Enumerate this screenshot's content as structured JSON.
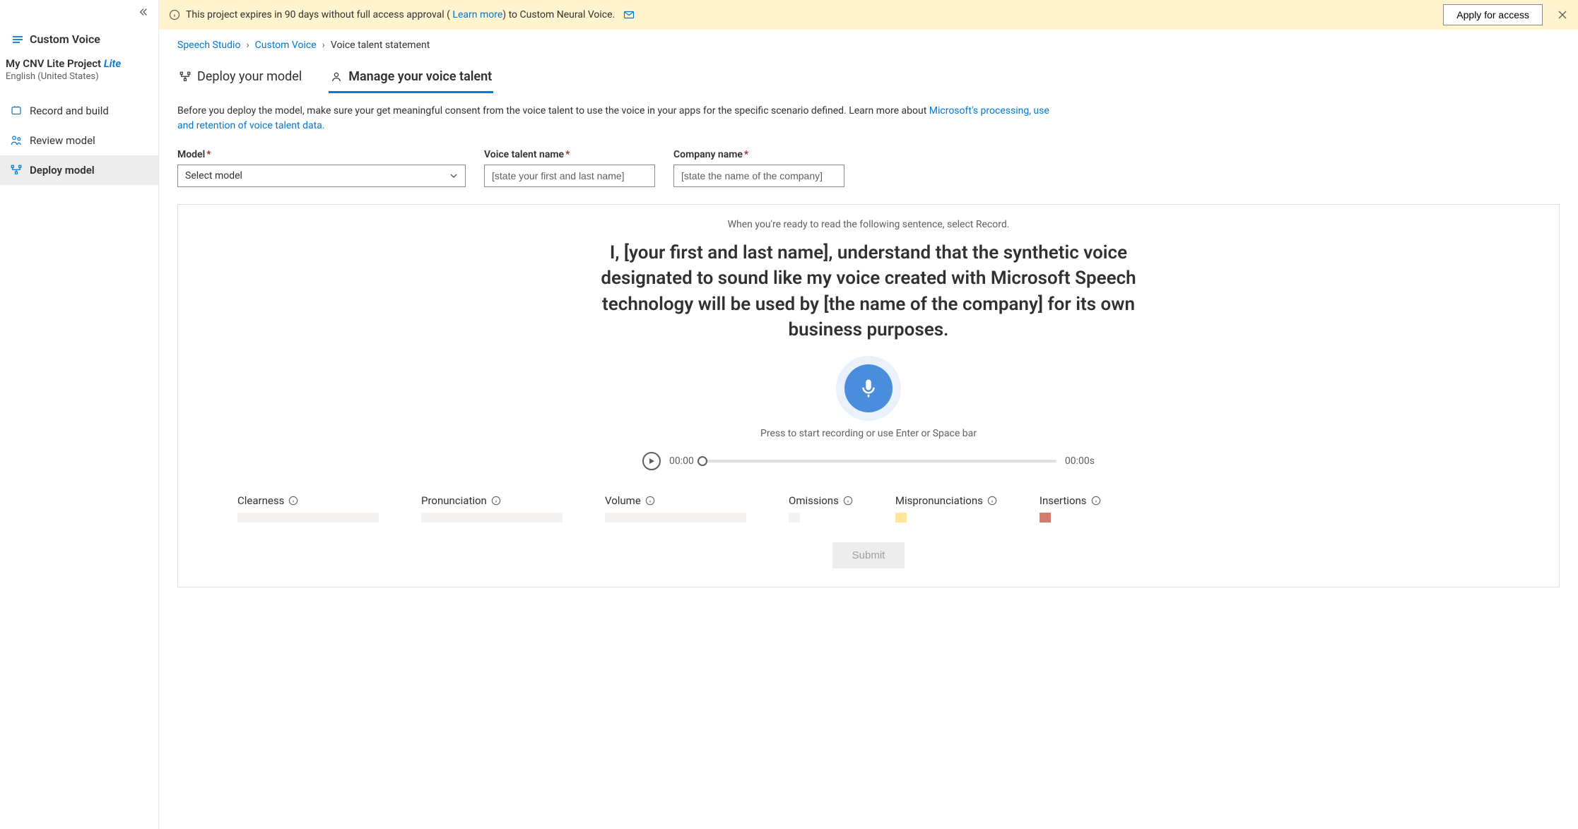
{
  "sidebar": {
    "app_name": "Custom Voice",
    "project_name": "My CNV Lite Project",
    "project_badge": "Lite",
    "project_lang": "English (United States)",
    "items": [
      {
        "label": "Record and build"
      },
      {
        "label": "Review model"
      },
      {
        "label": "Deploy model"
      }
    ]
  },
  "banner": {
    "text_pre": "This project expires in 90 days without full access approval ( ",
    "learn_more": "Learn more",
    "text_post": ") to Custom Neural Voice.",
    "apply_btn": "Apply for access"
  },
  "breadcrumb": {
    "a": "Speech Studio",
    "b": "Custom Voice",
    "c": "Voice talent statement"
  },
  "tabs": {
    "deploy": "Deploy your model",
    "manage": "Manage your voice talent"
  },
  "desc": {
    "text": "Before you deploy the model, make sure your get meaningful consent from the voice talent to use the voice in your apps for the specific scenario defined. Learn more about ",
    "link": "Microsoft's processing, use and retention of voice talent data."
  },
  "form": {
    "model_label": "Model",
    "model_placeholder": "Select model",
    "talent_label": "Voice talent name",
    "talent_placeholder": "[state your first and last name]",
    "company_label": "Company name",
    "company_placeholder": "[state the name of the company]"
  },
  "panel": {
    "hint": "When you're ready to read the following sentence, select Record.",
    "statement": "I, [your first and last name], understand that the synthetic voice designated to sound like my voice created with Microsoft Speech technology will be used by [the name of the company] for its own business purposes.",
    "mic_hint": "Press to start recording or use Enter or Space bar",
    "time_start": "00:00",
    "time_total": "00:00s",
    "metrics": {
      "clearness": "Clearness",
      "pronunciation": "Pronunciation",
      "volume": "Volume",
      "omissions": "Omissions",
      "mispronunciations": "Mispronunciations",
      "insertions": "Insertions"
    },
    "submit": "Submit"
  }
}
